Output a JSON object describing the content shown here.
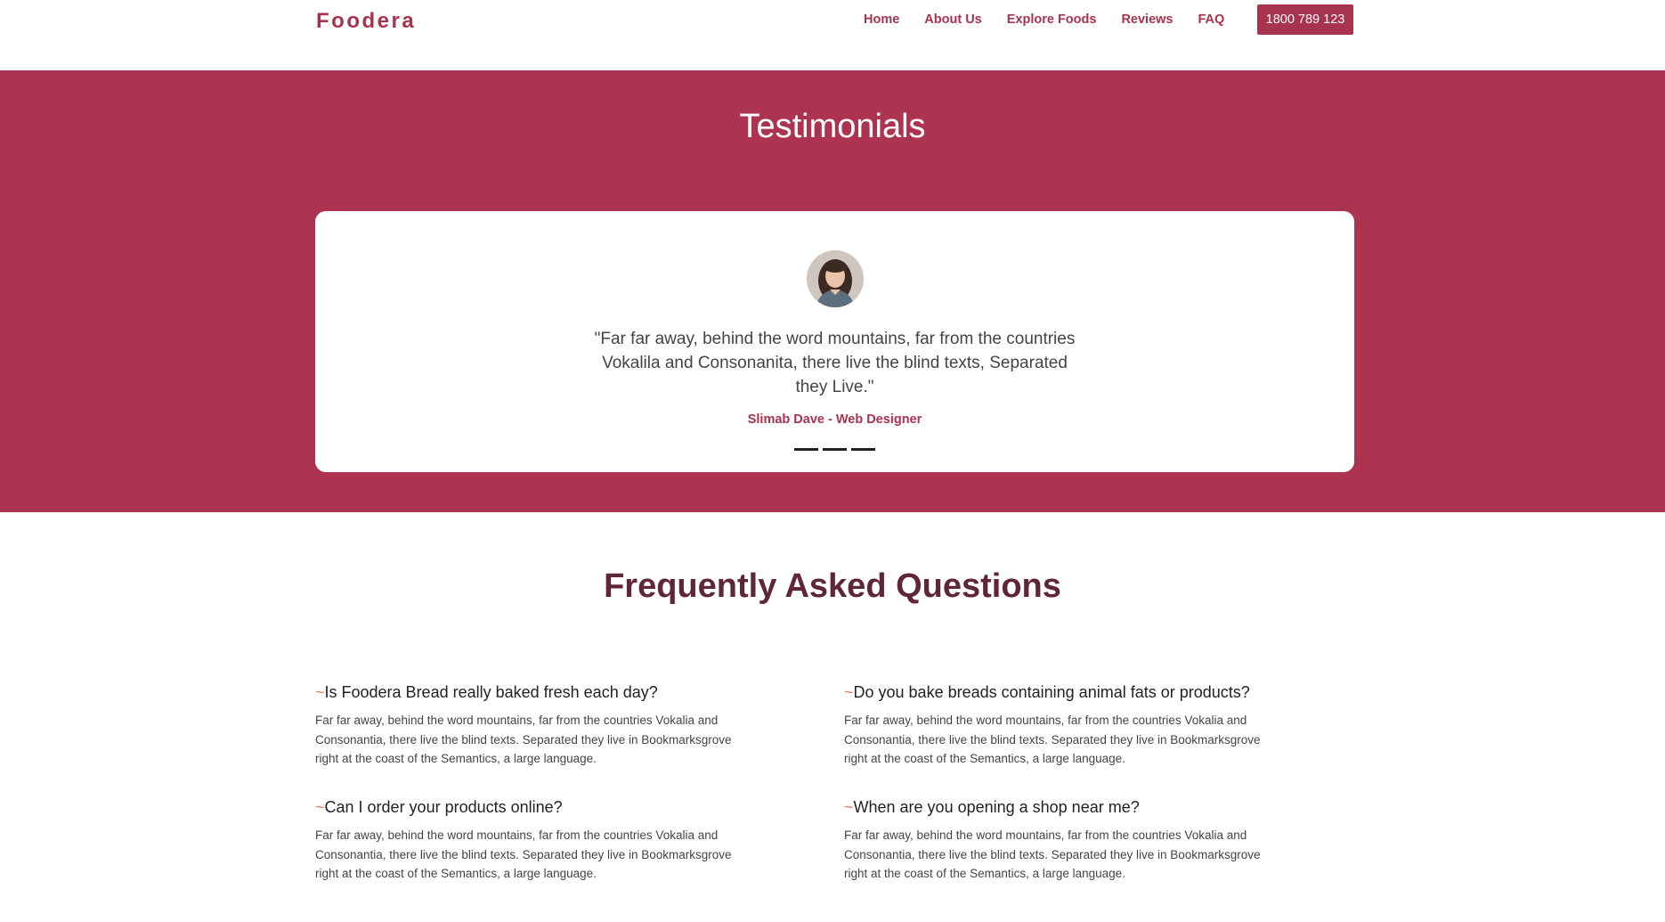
{
  "nav": {
    "brand": "Foodera",
    "links": [
      "Home",
      "About Us",
      "Explore Foods",
      "Reviews",
      "FAQ"
    ],
    "phone": "1800 789 123"
  },
  "testimonials": {
    "title": "Testimonials",
    "quote": "\"Far far away, behind the word mountains, far from the countries Vokalila and Consonanita, there live the blind texts, Separated they Live.\"",
    "author": "Slimab Dave - Web Designer",
    "dots_count": 3
  },
  "faq": {
    "title": "Frequently Asked Questions",
    "items": [
      {
        "q": "Is Foodera Bread really baked fresh each day?",
        "a": "Far far away, behind the word mountains, far from the countries Vokalia and Consonantia, there live the blind texts. Separated they live in Bookmarksgrove right at the coast of the Semantics, a large language."
      },
      {
        "q": "Do you bake breads containing animal fats or products?",
        "a": "Far far away, behind the word mountains, far from the countries Vokalia and Consonantia, there live the blind texts. Separated they live in Bookmarksgrove right at the coast of the Semantics, a large language."
      },
      {
        "q": "Can I order your products online?",
        "a": "Far far away, behind the word mountains, far from the countries Vokalia and Consonantia, there live the blind texts. Separated they live in Bookmarksgrove right at the coast of the Semantics, a large language."
      },
      {
        "q": "When are you opening a shop near me?",
        "a": "Far far away, behind the word mountains, far from the countries Vokalia and Consonantia, there live the blind texts. Separated they live in Bookmarksgrove right at the coast of the Semantics, a large language."
      }
    ],
    "marker": "~"
  },
  "colors": {
    "brand": "#a8334f",
    "hero_bg": "#ad3450",
    "faq_title": "#5e2638",
    "marker": "#e07b5a"
  }
}
